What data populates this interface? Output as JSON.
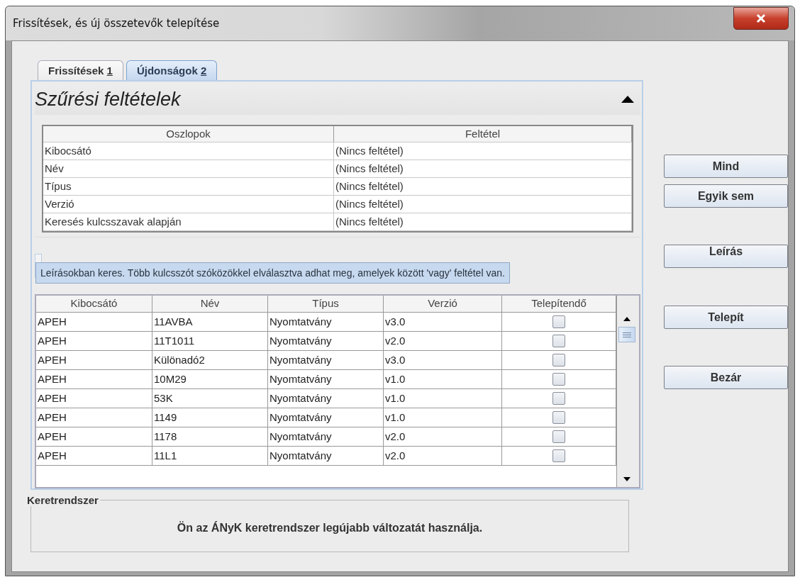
{
  "window": {
    "title": "Frissítések, és új összetevők telepítése"
  },
  "tabs": [
    {
      "label": "Frissítések",
      "key": "1",
      "selected": false
    },
    {
      "label": "Újdonságok",
      "key": "2",
      "selected": true
    }
  ],
  "filter": {
    "title": "Szűrési feltételek",
    "expanded": true,
    "columns": [
      "Oszlopok",
      "Feltétel"
    ],
    "rows": [
      {
        "column": "Kibocsátó",
        "condition": "(Nincs feltétel)"
      },
      {
        "column": "Név",
        "condition": "(Nincs feltétel)"
      },
      {
        "column": "Típus",
        "condition": "(Nincs feltétel)"
      },
      {
        "column": "Verzió",
        "condition": "(Nincs feltétel)"
      },
      {
        "column": "Keresés kulcsszavak alapján",
        "condition": "(Nincs feltétel)"
      }
    ]
  },
  "tooltip": "Leírásokban keres. Több kulcsszót szóközökkel elválasztva adhat meg, amelyek között 'vagy' feltétel van.",
  "table": {
    "columns": [
      "Kibocsátó",
      "Név",
      "Típus",
      "Verzió",
      "Telepítendő"
    ],
    "rows": [
      {
        "issuer": "APEH",
        "name": "11AVBA",
        "type": "Nyomtatvány",
        "version": "v3.0",
        "install": false
      },
      {
        "issuer": "APEH",
        "name": "11T1011",
        "type": "Nyomtatvány",
        "version": "v2.0",
        "install": false
      },
      {
        "issuer": "APEH",
        "name": "Különadó2",
        "type": "Nyomtatvány",
        "version": "v3.0",
        "install": false
      },
      {
        "issuer": "APEH",
        "name": "10M29",
        "type": "Nyomtatvány",
        "version": "v1.0",
        "install": false
      },
      {
        "issuer": "APEH",
        "name": "53K",
        "type": "Nyomtatvány",
        "version": "v1.0",
        "install": false
      },
      {
        "issuer": "APEH",
        "name": "1149",
        "type": "Nyomtatvány",
        "version": "v1.0",
        "install": false
      },
      {
        "issuer": "APEH",
        "name": "1178",
        "type": "Nyomtatvány",
        "version": "v2.0",
        "install": false
      },
      {
        "issuer": "APEH",
        "name": "11L1",
        "type": "Nyomtatvány",
        "version": "v2.0",
        "install": false
      }
    ]
  },
  "buttons": [
    {
      "label": "Mind"
    },
    {
      "label": "Egyik sem"
    },
    {
      "label": "Leírás"
    },
    {
      "label": "Telepít"
    },
    {
      "label": "Bezár"
    }
  ],
  "framework": {
    "title": "Keretrendszer",
    "message": "Ön az ÁNyK keretrendszer legújabb változatát használja."
  }
}
